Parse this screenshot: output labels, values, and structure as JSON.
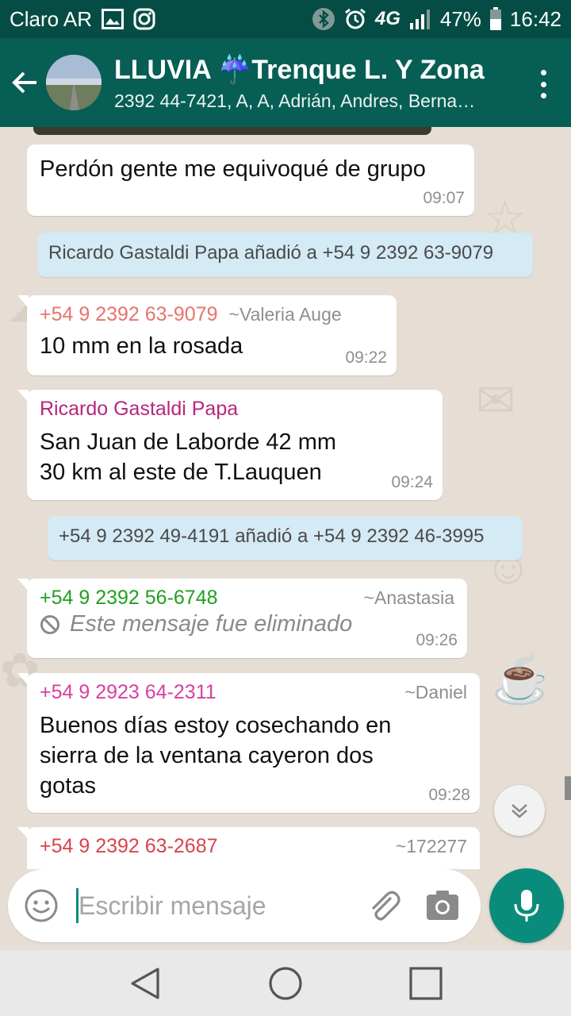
{
  "status_bar": {
    "carrier": "Claro AR",
    "network": "4G",
    "battery": "47%",
    "time": "16:42"
  },
  "header": {
    "title": "LLUVIA ☔Trenque L. Y Zona",
    "participants": "2392 44-7421, A, A, Adrián, Andres, Berna…"
  },
  "messages": [
    {
      "text": "Perdón gente me equivoqué de grupo",
      "time": "09:07"
    },
    {
      "system": "Ricardo Gastaldi Papa añadió a +54 9 2392 63-9079"
    },
    {
      "sender": "+54 9 2392 63-9079",
      "alias": "~Valeria Auge",
      "sender_color": "#e8736b",
      "text": "10 mm en la rosada",
      "time": "09:22"
    },
    {
      "sender": "Ricardo Gastaldi Papa",
      "sender_color": "#b8267c",
      "line1": "San Juan de Laborde 42 mm",
      "line2": "30 km al este de T.Lauquen",
      "time": "09:24"
    },
    {
      "system": "+54 9 2392 49-4191 añadió a +54 9 2392 46-3995"
    },
    {
      "sender": "+54 9 2392 56-6748",
      "alias": "~Anastasia",
      "sender_color": "#20a020",
      "text": "Este mensaje fue eliminado",
      "time": "09:26"
    },
    {
      "sender": "+54 9 2923 64-2311",
      "alias": "~Daniel",
      "sender_color": "#d93fa0",
      "line1": "Buenos días estoy  cosechando en",
      "line2": "sierra de la ventana cayeron dos",
      "line3": "gotas",
      "time": "09:28"
    },
    {
      "sender": "+54 9 2392 63-2687",
      "alias": "~172277",
      "sender_color": "#d9434a"
    }
  ],
  "composer": {
    "placeholder": "Escribir mensaje"
  },
  "colors": {
    "header": "#075e54",
    "status_bar": "#054d44",
    "accent": "#0a8c7c",
    "system_bubble": "#d4eaf4"
  },
  "icons": [
    "back-arrow-icon",
    "menu-icon",
    "emoji-icon",
    "attach-icon",
    "camera-icon",
    "mic-icon",
    "chevron-down-icon",
    "blocked-icon",
    "nav-back-icon",
    "nav-home-icon",
    "nav-recents-icon"
  ]
}
